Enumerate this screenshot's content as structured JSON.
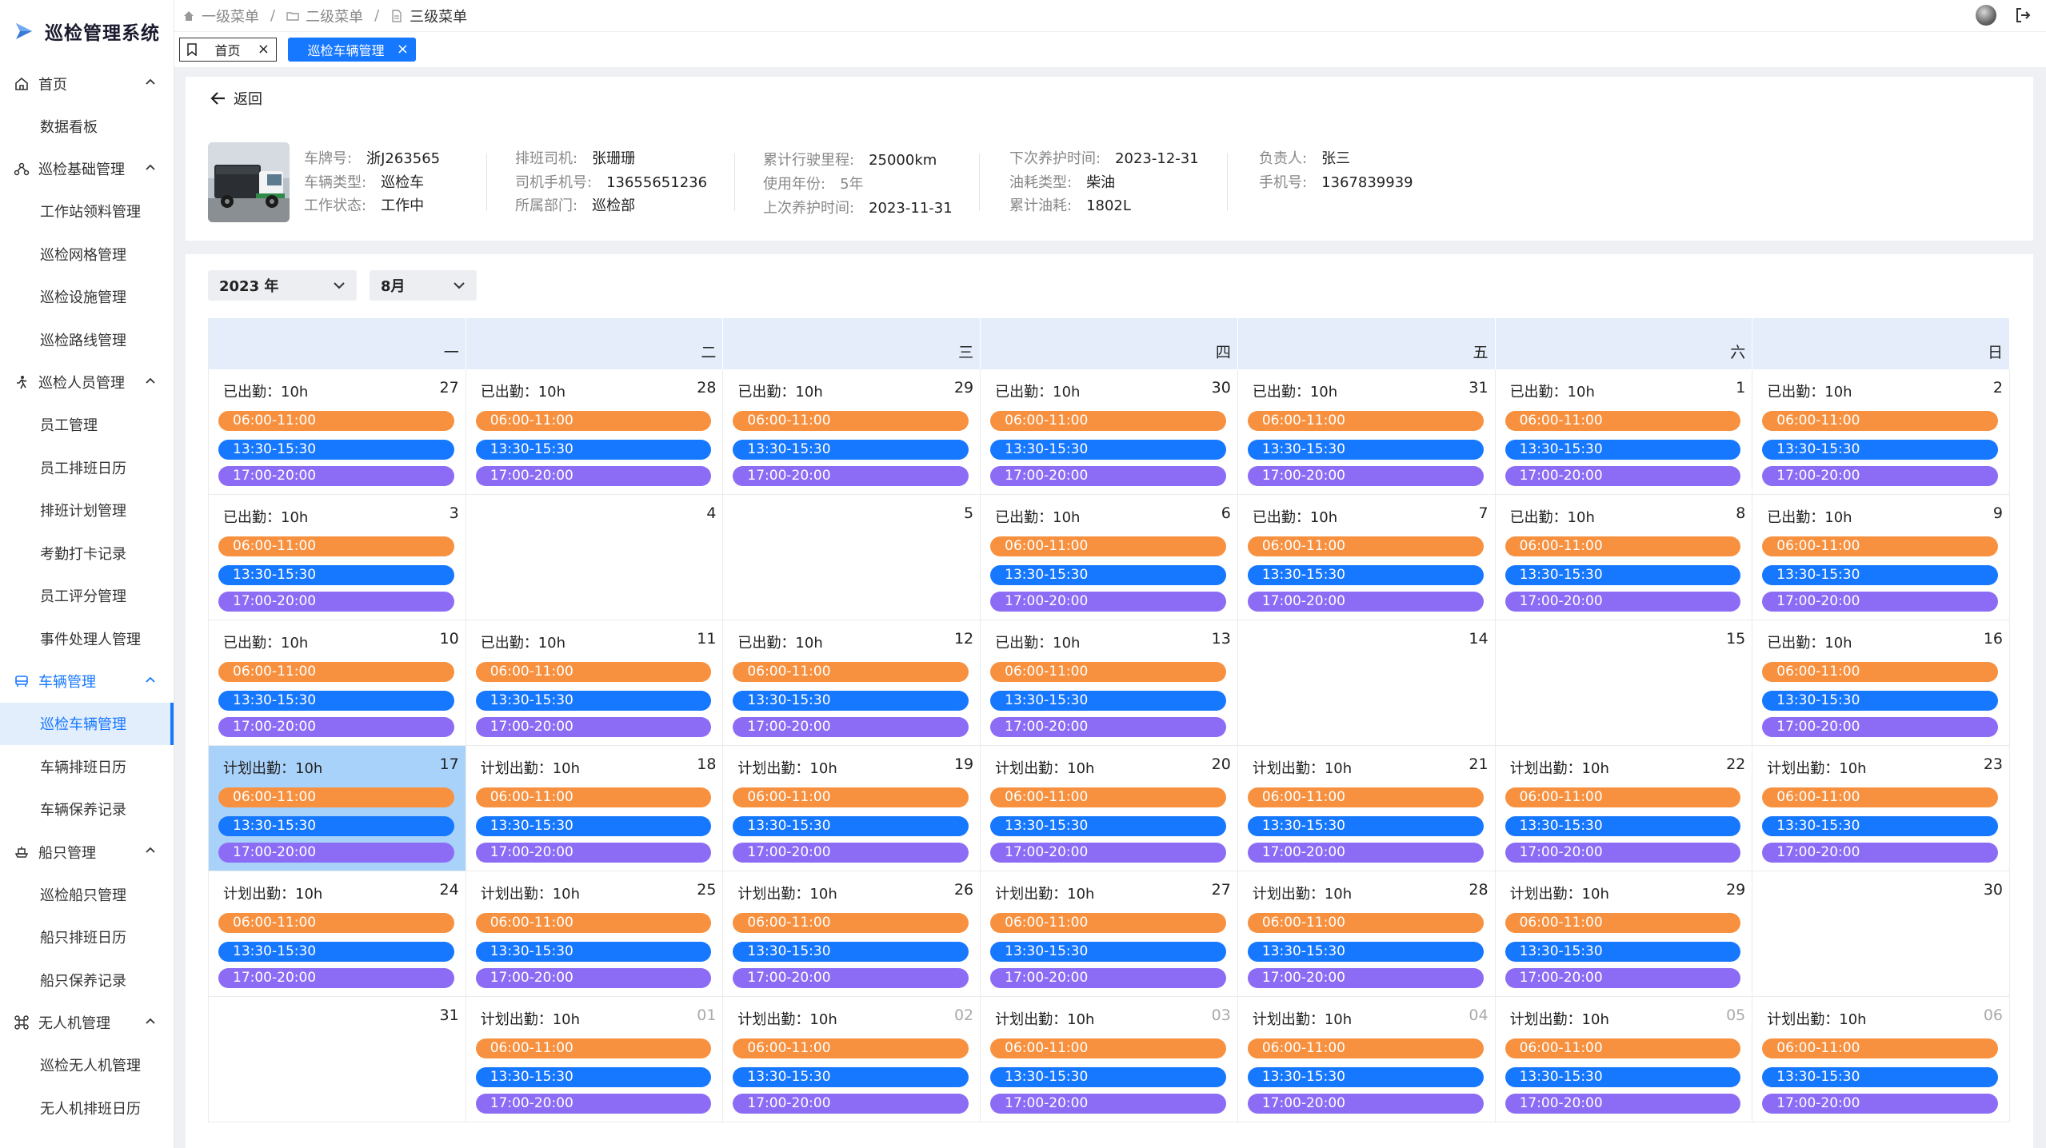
{
  "app": {
    "title": "巡检管理系统"
  },
  "sidebar": {
    "groups": [
      {
        "label": "首页",
        "icon": "home-icon",
        "children": [
          "数据看板"
        ]
      },
      {
        "label": "巡检基础管理",
        "icon": "network-icon",
        "children": [
          "工作站领料管理",
          "巡检网格管理",
          "巡检设施管理",
          "巡检路线管理"
        ]
      },
      {
        "label": "巡检人员管理",
        "icon": "person-icon",
        "children": [
          "员工管理",
          "员工排班日历",
          "排班计划管理",
          "考勤打卡记录",
          "员工评分管理",
          "事件处理人管理"
        ]
      },
      {
        "label": "车辆管理",
        "icon": "vehicle-icon",
        "children": [
          "巡检车辆管理",
          "车辆排班日历",
          "车辆保养记录"
        ]
      },
      {
        "label": "船只管理",
        "icon": "ship-icon",
        "children": [
          "巡检船只管理",
          "船只排班日历",
          "船只保养记录"
        ]
      },
      {
        "label": "无人机管理",
        "icon": "drone-icon",
        "children": [
          "巡检无人机管理",
          "无人机排班日历"
        ]
      }
    ],
    "active_group": "车辆管理",
    "active_item": "巡检车辆管理"
  },
  "breadcrumb": [
    "一级菜单",
    "二级菜单",
    "三级菜单"
  ],
  "tabs": {
    "home": "首页",
    "active": "巡检车辆管理",
    "close": "×"
  },
  "back_label": "返回",
  "vehicle": {
    "plate_k": "车牌号:",
    "plate_v": "浙J263565",
    "type_k": "车辆类型:",
    "type_v": "巡检车",
    "state_k": "工作状态:",
    "state_v": "工作中",
    "driver_k": "排班司机:",
    "driver_v": "张珊珊",
    "phone_k": "司机手机号:",
    "phone_v": "13655651236",
    "dept_k": "所属部门:",
    "dept_v": "巡检部",
    "mileage_k": "累计行驶里程:",
    "mileage_v": "25000km",
    "years_k": "使用年份:",
    "years_v": "5年",
    "last_k": "上次养护时间:",
    "last_v": "2023-11-31",
    "next_k": "下次养护时间:",
    "next_v": "2023-12-31",
    "fuel_k": "油耗类型:",
    "fuel_v": "柴油",
    "fuelsum_k": "累计油耗:",
    "fuelsum_v": "1802L",
    "owner_k": "负责人:",
    "owner_v": "张三",
    "ownerphone_k": "手机号:",
    "ownerphone_v": "1367839939"
  },
  "calendar": {
    "year": "2023 年",
    "month": "8月",
    "weekdays": [
      "一",
      "二",
      "三",
      "四",
      "五",
      "六",
      "日"
    ],
    "shifts": [
      "06:00-11:00",
      "13:30-15:30",
      "17:00-20:00"
    ],
    "cells": [
      {
        "day": "27",
        "status": "已出勤：10h",
        "shifts": true,
        "other": false
      },
      {
        "day": "28",
        "status": "已出勤：10h",
        "shifts": true,
        "other": false
      },
      {
        "day": "29",
        "status": "已出勤：10h",
        "shifts": true,
        "other": false
      },
      {
        "day": "30",
        "status": "已出勤：10h",
        "shifts": true,
        "other": false
      },
      {
        "day": "31",
        "status": "已出勤：10h",
        "shifts": true,
        "other": false
      },
      {
        "day": "1",
        "status": "已出勤：10h",
        "shifts": true,
        "other": false
      },
      {
        "day": "2",
        "status": "已出勤：10h",
        "shifts": true,
        "other": false
      },
      {
        "day": "3",
        "status": "已出勤：10h",
        "shifts": true,
        "other": false
      },
      {
        "day": "4",
        "status": "",
        "shifts": false,
        "other": false
      },
      {
        "day": "5",
        "status": "",
        "shifts": false,
        "other": false
      },
      {
        "day": "6",
        "status": "已出勤：10h",
        "shifts": true,
        "other": false
      },
      {
        "day": "7",
        "status": "已出勤：10h",
        "shifts": true,
        "other": false
      },
      {
        "day": "8",
        "status": "已出勤：10h",
        "shifts": true,
        "other": false
      },
      {
        "day": "9",
        "status": "已出勤：10h",
        "shifts": true,
        "other": false
      },
      {
        "day": "10",
        "status": "已出勤：10h",
        "shifts": true,
        "other": false
      },
      {
        "day": "11",
        "status": "已出勤：10h",
        "shifts": true,
        "other": false
      },
      {
        "day": "12",
        "status": "已出勤：10h",
        "shifts": true,
        "other": false
      },
      {
        "day": "13",
        "status": "已出勤：10h",
        "shifts": true,
        "other": false
      },
      {
        "day": "14",
        "status": "",
        "shifts": false,
        "other": false
      },
      {
        "day": "15",
        "status": "",
        "shifts": false,
        "other": false
      },
      {
        "day": "16",
        "status": "已出勤：10h",
        "shifts": true,
        "other": false
      },
      {
        "day": "17",
        "status": "计划出勤：10h",
        "shifts": true,
        "other": false,
        "selected": true
      },
      {
        "day": "18",
        "status": "计划出勤：10h",
        "shifts": true,
        "other": false
      },
      {
        "day": "19",
        "status": "计划出勤：10h",
        "shifts": true,
        "other": false
      },
      {
        "day": "20",
        "status": "计划出勤：10h",
        "shifts": true,
        "other": false
      },
      {
        "day": "21",
        "status": "计划出勤：10h",
        "shifts": true,
        "other": false
      },
      {
        "day": "22",
        "status": "计划出勤：10h",
        "shifts": true,
        "other": false
      },
      {
        "day": "23",
        "status": "计划出勤：10h",
        "shifts": true,
        "other": false
      },
      {
        "day": "24",
        "status": "计划出勤：10h",
        "shifts": true,
        "other": false
      },
      {
        "day": "25",
        "status": "计划出勤：10h",
        "shifts": true,
        "other": false
      },
      {
        "day": "26",
        "status": "计划出勤：10h",
        "shifts": true,
        "other": false
      },
      {
        "day": "27",
        "status": "计划出勤：10h",
        "shifts": true,
        "other": false
      },
      {
        "day": "28",
        "status": "计划出勤：10h",
        "shifts": true,
        "other": false
      },
      {
        "day": "29",
        "status": "计划出勤：10h",
        "shifts": true,
        "other": false
      },
      {
        "day": "30",
        "status": "",
        "shifts": false,
        "other": false
      },
      {
        "day": "31",
        "status": "",
        "shifts": false,
        "other": false
      },
      {
        "day": "01",
        "status": "计划出勤：10h",
        "shifts": true,
        "other": true
      },
      {
        "day": "02",
        "status": "计划出勤：10h",
        "shifts": true,
        "other": true
      },
      {
        "day": "03",
        "status": "计划出勤：10h",
        "shifts": true,
        "other": true
      },
      {
        "day": "04",
        "status": "计划出勤：10h",
        "shifts": true,
        "other": true
      },
      {
        "day": "05",
        "status": "计划出勤：10h",
        "shifts": true,
        "other": true
      },
      {
        "day": "06",
        "status": "计划出勤：10h",
        "shifts": true,
        "other": true
      }
    ]
  },
  "colors": {
    "accent": "#1677ff",
    "shift1": "#f7913f",
    "shift2": "#1677ff",
    "shift3": "#8c6cf5",
    "selected": "#a9d2fb",
    "header": "#e4edf9"
  }
}
